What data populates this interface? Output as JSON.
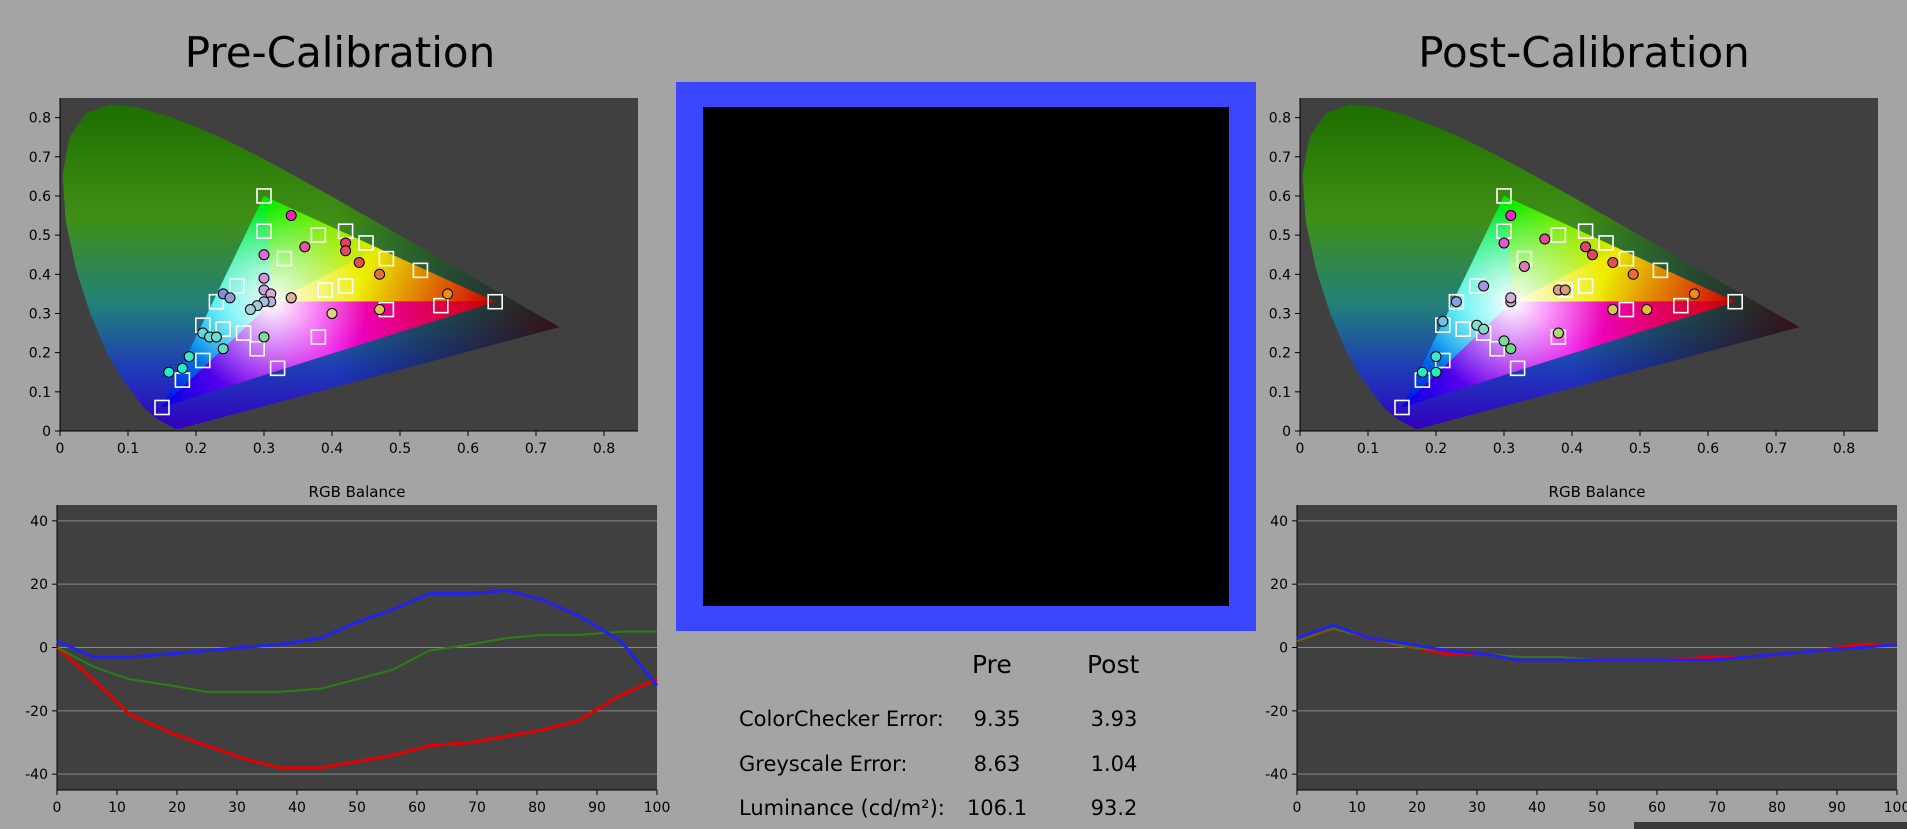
{
  "pre_title": "Pre-Calibration",
  "post_title": "Post-Calibration",
  "stats": {
    "header_pre": "Pre",
    "header_post": "Post",
    "rows": [
      {
        "label": "ColorChecker Error:",
        "pre": "9.35",
        "post": "3.93"
      },
      {
        "label": "Greyscale Error:",
        "pre": "8.63",
        "post": "1.04"
      },
      {
        "label": "Luminance (cd/m²):",
        "pre": "106.1",
        "post": "93.2"
      }
    ]
  },
  "colors": {
    "page_bg": "#a4a4a4",
    "plot_bg": "#404040",
    "frame_blue": "#3b47fe",
    "red_line": "#e60000",
    "green_line": "#2e7d10",
    "blue_line": "#2222ee"
  },
  "chart_data": [
    {
      "id": "pre-cie",
      "type": "scatter",
      "title": "",
      "xlim": [
        0,
        0.85
      ],
      "ylim": [
        0,
        0.85
      ],
      "xticks": [
        "0",
        "0.1",
        "0.2",
        "0.3",
        "0.4",
        "0.5",
        "0.6",
        "0.7",
        "0.8"
      ],
      "yticks": [
        "0",
        "0.1",
        "0.2",
        "0.3",
        "0.4",
        "0.5",
        "0.6",
        "0.7",
        "0.8"
      ],
      "gamut": [
        [
          0.64,
          0.33
        ],
        [
          0.3,
          0.6
        ],
        [
          0.15,
          0.06
        ]
      ],
      "series": [
        {
          "marker": "square",
          "points": [
            [
              0.3,
              0.6
            ],
            [
              0.3,
              0.51
            ],
            [
              0.33,
              0.44
            ],
            [
              0.38,
              0.5
            ],
            [
              0.42,
              0.51
            ],
            [
              0.45,
              0.48
            ],
            [
              0.48,
              0.44
            ],
            [
              0.53,
              0.41
            ],
            [
              0.64,
              0.33
            ],
            [
              0.56,
              0.32
            ],
            [
              0.48,
              0.31
            ],
            [
              0.42,
              0.37
            ],
            [
              0.39,
              0.36
            ],
            [
              0.38,
              0.24
            ],
            [
              0.31,
              0.33
            ],
            [
              0.32,
              0.16
            ],
            [
              0.29,
              0.21
            ],
            [
              0.27,
              0.25
            ],
            [
              0.24,
              0.26
            ],
            [
              0.21,
              0.18
            ],
            [
              0.18,
              0.13
            ],
            [
              0.15,
              0.06
            ],
            [
              0.21,
              0.27
            ],
            [
              0.23,
              0.33
            ],
            [
              0.26,
              0.37
            ]
          ]
        },
        {
          "marker": "circle",
          "points": [
            [
              0.34,
              0.55
            ],
            [
              0.36,
              0.47
            ],
            [
              0.3,
              0.45
            ],
            [
              0.42,
              0.48
            ],
            [
              0.42,
              0.46
            ],
            [
              0.44,
              0.43
            ],
            [
              0.47,
              0.4
            ],
            [
              0.57,
              0.35
            ],
            [
              0.47,
              0.31
            ],
            [
              0.4,
              0.3
            ],
            [
              0.3,
              0.39
            ],
            [
              0.3,
              0.36
            ],
            [
              0.34,
              0.34
            ],
            [
              0.34,
              0.34
            ],
            [
              0.31,
              0.35
            ],
            [
              0.31,
              0.33
            ],
            [
              0.3,
              0.33
            ],
            [
              0.29,
              0.32
            ],
            [
              0.28,
              0.31
            ],
            [
              0.24,
              0.35
            ],
            [
              0.25,
              0.34
            ],
            [
              0.21,
              0.25
            ],
            [
              0.22,
              0.24
            ],
            [
              0.23,
              0.24
            ],
            [
              0.24,
              0.21
            ],
            [
              0.19,
              0.19
            ],
            [
              0.18,
              0.16
            ],
            [
              0.16,
              0.15
            ],
            [
              0.3,
              0.24
            ]
          ]
        }
      ]
    },
    {
      "id": "pre-rgb",
      "type": "line",
      "title": "RGB Balance",
      "xlim": [
        0,
        100
      ],
      "ylim": [
        -45,
        45
      ],
      "xticks": [
        "0",
        "10",
        "20",
        "30",
        "40",
        "50",
        "60",
        "70",
        "80",
        "90",
        "100"
      ],
      "yticks": [
        "40",
        "20",
        "0",
        "-20",
        "-40"
      ],
      "x": [
        0,
        6,
        12,
        19,
        25,
        31,
        37,
        44,
        50,
        56,
        62,
        69,
        75,
        81,
        87,
        94,
        100
      ],
      "series": [
        {
          "color": "red",
          "values": [
            0,
            -10,
            -21,
            -27,
            -31,
            -35,
            -38,
            -38,
            -36,
            -34,
            -31,
            -30,
            -28,
            -26,
            -23,
            -15,
            -10
          ]
        },
        {
          "color": "green",
          "values": [
            0,
            -6,
            -10,
            -12,
            -14,
            -14,
            -14,
            -13,
            -10,
            -7,
            -1,
            1,
            3,
            4,
            4,
            5,
            5
          ]
        },
        {
          "color": "blue",
          "values": [
            2,
            -3,
            -3,
            -2,
            -1,
            0,
            1,
            3,
            8,
            12,
            17,
            17,
            18,
            15,
            10,
            2,
            -12
          ]
        }
      ]
    },
    {
      "id": "post-cie",
      "type": "scatter",
      "title": "",
      "xlim": [
        0,
        0.85
      ],
      "ylim": [
        0,
        0.85
      ],
      "xticks": [
        "0",
        "0.1",
        "0.2",
        "0.3",
        "0.4",
        "0.5",
        "0.6",
        "0.7",
        "0.8"
      ],
      "yticks": [
        "0",
        "0.1",
        "0.2",
        "0.3",
        "0.4",
        "0.5",
        "0.6",
        "0.7",
        "0.8"
      ],
      "gamut": [
        [
          0.64,
          0.33
        ],
        [
          0.3,
          0.6
        ],
        [
          0.15,
          0.06
        ]
      ],
      "series": [
        {
          "marker": "square",
          "points": [
            [
              0.3,
              0.6
            ],
            [
              0.3,
              0.51
            ],
            [
              0.33,
              0.44
            ],
            [
              0.38,
              0.5
            ],
            [
              0.42,
              0.51
            ],
            [
              0.45,
              0.48
            ],
            [
              0.48,
              0.44
            ],
            [
              0.53,
              0.41
            ],
            [
              0.64,
              0.33
            ],
            [
              0.56,
              0.32
            ],
            [
              0.48,
              0.31
            ],
            [
              0.42,
              0.37
            ],
            [
              0.39,
              0.36
            ],
            [
              0.38,
              0.24
            ],
            [
              0.31,
              0.33
            ],
            [
              0.32,
              0.16
            ],
            [
              0.29,
              0.21
            ],
            [
              0.27,
              0.25
            ],
            [
              0.24,
              0.26
            ],
            [
              0.21,
              0.18
            ],
            [
              0.18,
              0.13
            ],
            [
              0.15,
              0.06
            ],
            [
              0.21,
              0.27
            ],
            [
              0.23,
              0.33
            ],
            [
              0.26,
              0.37
            ]
          ]
        },
        {
          "marker": "circle",
          "points": [
            [
              0.31,
              0.55
            ],
            [
              0.36,
              0.49
            ],
            [
              0.3,
              0.48
            ],
            [
              0.42,
              0.47
            ],
            [
              0.43,
              0.45
            ],
            [
              0.46,
              0.43
            ],
            [
              0.49,
              0.4
            ],
            [
              0.58,
              0.35
            ],
            [
              0.46,
              0.31
            ],
            [
              0.51,
              0.31
            ],
            [
              0.38,
              0.36
            ],
            [
              0.39,
              0.36
            ],
            [
              0.33,
              0.42
            ],
            [
              0.31,
              0.33
            ],
            [
              0.31,
              0.34
            ],
            [
              0.27,
              0.37
            ],
            [
              0.21,
              0.28
            ],
            [
              0.23,
              0.33
            ],
            [
              0.26,
              0.27
            ],
            [
              0.27,
              0.26
            ],
            [
              0.3,
              0.23
            ],
            [
              0.31,
              0.21
            ],
            [
              0.38,
              0.25
            ],
            [
              0.2,
              0.19
            ],
            [
              0.2,
              0.15
            ],
            [
              0.18,
              0.15
            ]
          ]
        }
      ]
    },
    {
      "id": "post-rgb",
      "type": "line",
      "title": "RGB Balance",
      "xlim": [
        0,
        100
      ],
      "ylim": [
        -45,
        45
      ],
      "xticks": [
        "0",
        "10",
        "20",
        "30",
        "40",
        "50",
        "60",
        "70",
        "80",
        "90",
        "100"
      ],
      "yticks": [
        "40",
        "20",
        "0",
        "-20",
        "-40"
      ],
      "x": [
        0,
        6,
        12,
        19,
        25,
        31,
        37,
        44,
        50,
        56,
        62,
        69,
        75,
        81,
        87,
        94,
        100
      ],
      "series": [
        {
          "color": "red",
          "values": [
            2,
            6,
            3,
            0,
            -2,
            -2,
            -4,
            -4,
            -4,
            -4,
            -4,
            -3,
            -3,
            -2,
            -1,
            1,
            1
          ]
        },
        {
          "color": "green",
          "values": [
            2,
            6,
            3,
            0,
            -1,
            -2,
            -3,
            -3,
            -4,
            -4,
            -4,
            -4,
            -3,
            -2,
            -1,
            0,
            1
          ]
        },
        {
          "color": "blue",
          "values": [
            3,
            7,
            3,
            1,
            -1,
            -2,
            -4,
            -4,
            -4,
            -4,
            -4,
            -4,
            -3,
            -2,
            -1,
            0,
            1
          ]
        }
      ]
    }
  ]
}
